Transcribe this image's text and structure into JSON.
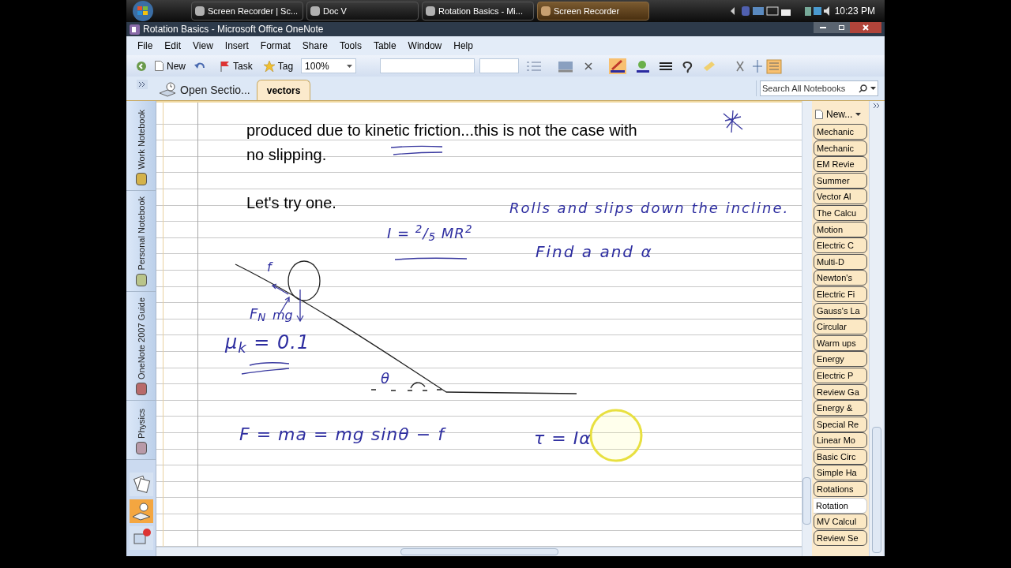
{
  "taskbar": {
    "buttons": [
      {
        "label": "Screen Recorder | Sc...",
        "selected": false
      },
      {
        "label": "Doc V",
        "selected": false
      },
      {
        "label": "Rotation Basics - Mi...",
        "selected": false
      },
      {
        "label": "Screen Recorder",
        "selected": true
      }
    ],
    "clock": "10:23 PM"
  },
  "window": {
    "title": "Rotation Basics - Microsoft Office OneNote"
  },
  "menu": [
    "File",
    "Edit",
    "View",
    "Insert",
    "Format",
    "Share",
    "Tools",
    "Table",
    "Window",
    "Help"
  ],
  "toolbar": {
    "new": "New",
    "task": "Task",
    "tag": "Tag",
    "zoom": "100%"
  },
  "section_tabs": {
    "open_sections": "Open Sectio...",
    "tabs": [
      {
        "label": "vectors",
        "selected": true
      }
    ]
  },
  "search": {
    "placeholder": "Search All Notebooks"
  },
  "notebooks": [
    {
      "label": "Work Notebook",
      "color": "#d4b24a"
    },
    {
      "label": "Personal Notebook",
      "color": "#b9c48a"
    },
    {
      "label": "OneNote 2007 Guide",
      "color": "#b86a6a"
    },
    {
      "label": "Physics",
      "color": "#b89aa8"
    }
  ],
  "page": {
    "typed": [
      {
        "lines": [
          "produced due to kinetic friction...this is not the case with",
          "no slipping."
        ]
      },
      {
        "lines": [
          "Let's try one."
        ]
      }
    ],
    "ink": [
      {
        "kind": "note",
        "text": "Rolls and slips down the incline."
      },
      {
        "kind": "note",
        "text": "Find a and α"
      },
      {
        "kind": "equation",
        "text": "I = $^{2}$/$_{5}$ MR$^{2}$"
      },
      {
        "kind": "label",
        "text": "f"
      },
      {
        "kind": "label",
        "text": "F$_{N}$"
      },
      {
        "kind": "label",
        "text": "mg"
      },
      {
        "kind": "equation",
        "text": "μ$_{k}$ = 0.1"
      },
      {
        "kind": "label",
        "text": "θ"
      },
      {
        "kind": "equation",
        "text": "F = ma = mg sinθ − f"
      },
      {
        "kind": "equation",
        "text": "τ = Iα"
      }
    ]
  },
  "pages": {
    "new_page": "New...",
    "items": [
      {
        "label": "Mechanic",
        "selected": false
      },
      {
        "label": "Mechanic",
        "selected": false
      },
      {
        "label": "EM Revie",
        "selected": false
      },
      {
        "label": "Summer",
        "selected": false
      },
      {
        "label": "Vector Al",
        "selected": false
      },
      {
        "label": "The Calcu",
        "selected": false
      },
      {
        "label": "Motion",
        "selected": false
      },
      {
        "label": "Electric C",
        "selected": false
      },
      {
        "label": "Multi-D",
        "selected": false
      },
      {
        "label": "Newton's",
        "selected": false
      },
      {
        "label": "Electric Fi",
        "selected": false
      },
      {
        "label": "Gauss's La",
        "selected": false
      },
      {
        "label": "Circular",
        "selected": false
      },
      {
        "label": "Warm ups",
        "selected": false
      },
      {
        "label": "Energy",
        "selected": false
      },
      {
        "label": "Electric P",
        "selected": false
      },
      {
        "label": "Review Ga",
        "selected": false
      },
      {
        "label": "Energy &",
        "selected": false
      },
      {
        "label": "Special Re",
        "selected": false
      },
      {
        "label": "Linear Mo",
        "selected": false
      },
      {
        "label": "Basic Circ",
        "selected": false
      },
      {
        "label": "Simple Ha",
        "selected": false
      },
      {
        "label": "Rotations",
        "selected": false
      },
      {
        "label": "Rotation",
        "selected": true
      },
      {
        "label": "MV Calcul",
        "selected": false
      },
      {
        "label": "Review Se",
        "selected": false
      }
    ]
  }
}
